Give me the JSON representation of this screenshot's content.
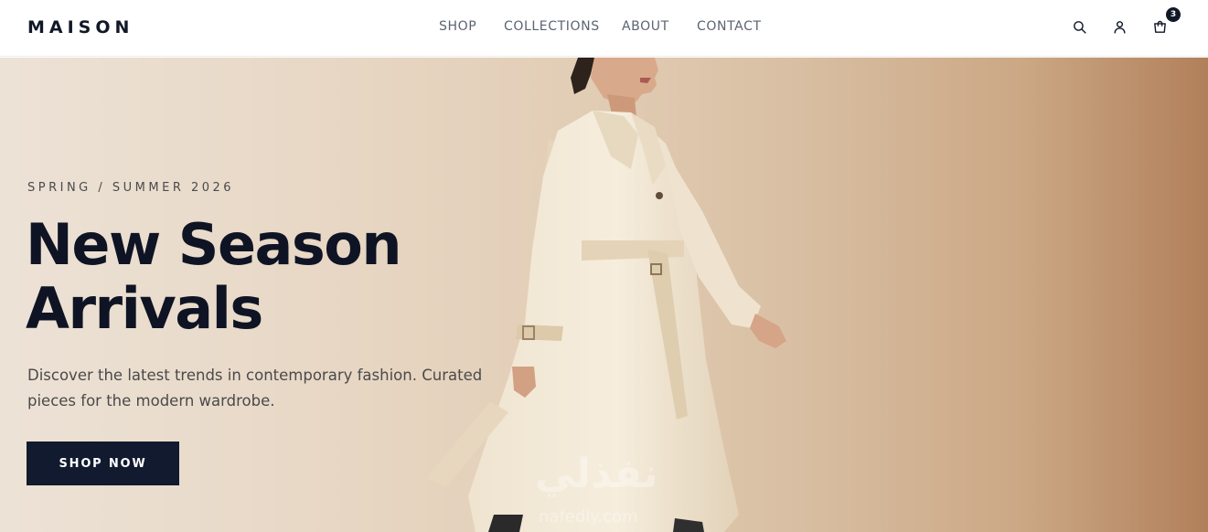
{
  "brand": {
    "logo": "MAISON"
  },
  "nav": {
    "items": [
      {
        "label": "SHOP"
      },
      {
        "label": "COLLECTIONS"
      },
      {
        "label": "ABOUT"
      },
      {
        "label": "CONTACT"
      }
    ]
  },
  "header_icons": {
    "search": "search-icon",
    "account": "user-icon",
    "cart": "shopping-bag-icon",
    "cart_count": "3"
  },
  "hero": {
    "eyebrow": "SPRING / SUMMER 2026",
    "headline_line1": "New Season",
    "headline_line2": "Arrivals",
    "subtext": "Discover the latest trends in contemporary fashion. Curated pieces for the modern wardrobe.",
    "cta_label": "SHOP NOW",
    "image": "model-walking-in-cream-trench-coat"
  },
  "watermark": {
    "text": "نفذلي",
    "subtext": "nafedly.com"
  },
  "colors": {
    "accent": "#111a2e",
    "headline": "#0f1424",
    "nav_text": "#5b6472",
    "hero_bg_start": "#ece2d6",
    "hero_bg_end": "#b1805a"
  }
}
